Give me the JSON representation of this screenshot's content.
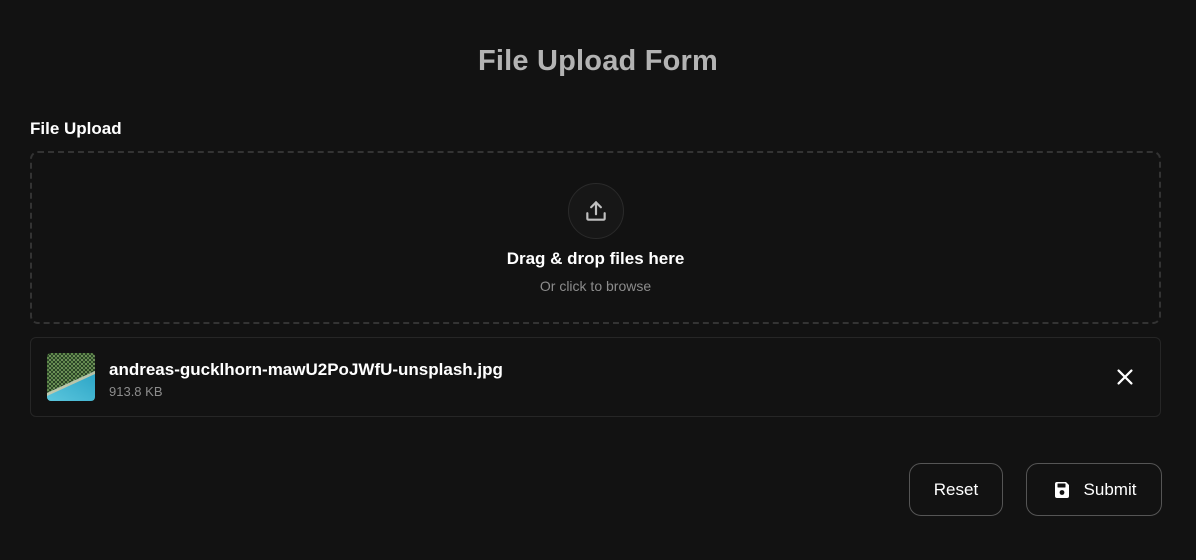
{
  "form": {
    "title": "File Upload Form"
  },
  "upload": {
    "label": "File Upload",
    "dropzone": {
      "primary_text": "Drag & drop files here",
      "secondary_text": "Or click to browse",
      "icon": "upload-icon"
    },
    "files": [
      {
        "name": "andreas-gucklhorn-mawU2PoJWfU-unsplash.jpg",
        "size": "913.8 KB",
        "thumbnail_icon": "image-thumbnail",
        "remove_icon": "close-icon"
      }
    ]
  },
  "actions": {
    "reset_label": "Reset",
    "submit_label": "Submit",
    "submit_icon": "save-icon"
  },
  "colors": {
    "background": "#121212",
    "title": "#b3b3b3",
    "text": "#ffffff",
    "muted": "#8c8c8c",
    "border": "#333333"
  }
}
